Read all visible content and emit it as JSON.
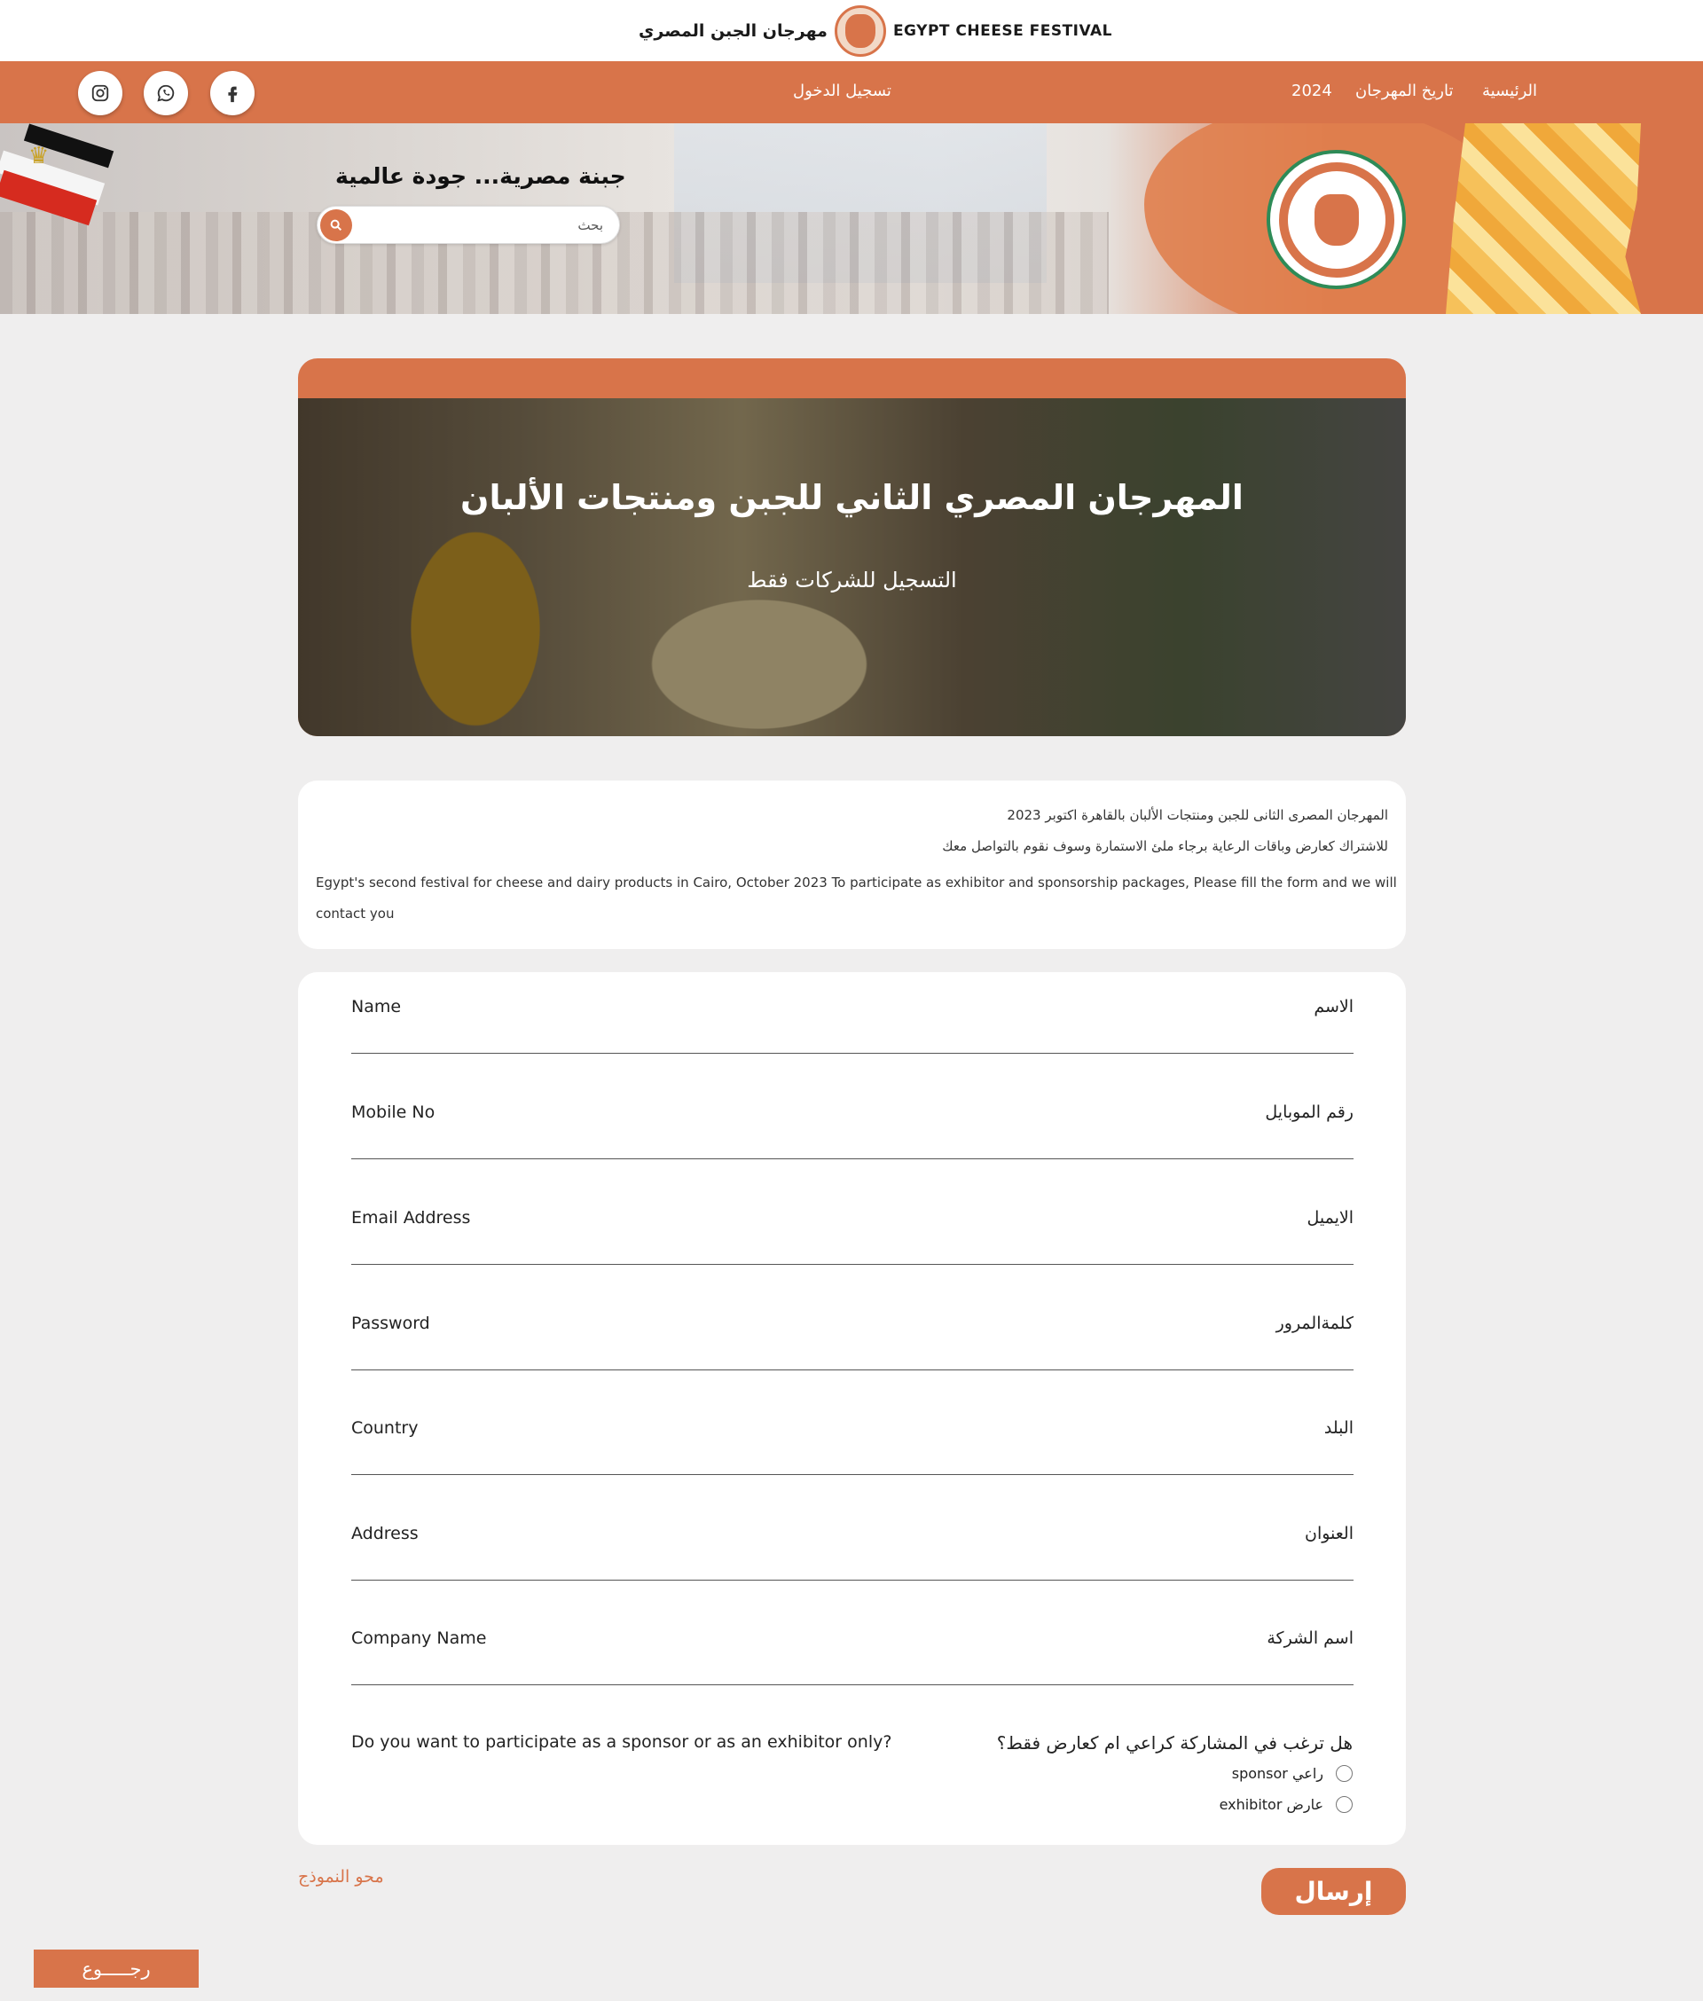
{
  "header": {
    "brand_ar": "مهرجان الجبن المصري",
    "brand_en": "EGYPT CHEESE FESTIVAL"
  },
  "nav": {
    "home": "الرئيسية",
    "history": "تاريخ المهرجان",
    "year": "2024",
    "login": "تسجيل الدخول",
    "social": [
      "facebook-icon",
      "whatsapp-icon",
      "instagram-icon"
    ]
  },
  "hero": {
    "slogan": "جبنة مصرية... جودة عالمية",
    "search_placeholder": "بحث"
  },
  "banner": {
    "title": "المهرجان المصري الثاني للجبن ومنتجات الألبان",
    "subtitle": "التسجيل للشركات فقط"
  },
  "info": {
    "line1_ar": "المهرجان المصرى الثانى للجبن ومنتجات الألبان بالقاهرة اكتوبر 2023",
    "line2_ar": "للاشتراك كعارض وباقات الرعاية برجاء ملئ الاستمارة وسوف نقوم بالتواصل معك",
    "text_en": "Egypt's second festival for cheese and dairy products in Cairo, October 2023 To participate as exhibitor and sponsorship packages, Please fill the form and we will contact you"
  },
  "form": {
    "fields": [
      {
        "en": "Name",
        "ar": "الاسم"
      },
      {
        "en": "Mobile No",
        "ar": "رقم الموبايل"
      },
      {
        "en": "Email Address",
        "ar": "الايميل"
      },
      {
        "en": "Password",
        "ar": "كلمةالمرور"
      },
      {
        "en": "Country",
        "ar": "البلد"
      },
      {
        "en": "Address",
        "ar": "العنوان"
      },
      {
        "en": "Company Name",
        "ar": "اسم الشركة"
      }
    ],
    "question_en": "Do you want to participate as a sponsor or as an exhibitor only?",
    "question_ar": "هل ترغب في المشاركة كراعي ام كعارض فقط؟",
    "options": [
      "راعي sponsor",
      "عارض exhibitor"
    ]
  },
  "actions": {
    "clear": "محو النموذج",
    "submit": "إرسال",
    "back": "رجـــــوع"
  },
  "colors": {
    "accent": "#d8744a",
    "background": "#efeeee"
  }
}
